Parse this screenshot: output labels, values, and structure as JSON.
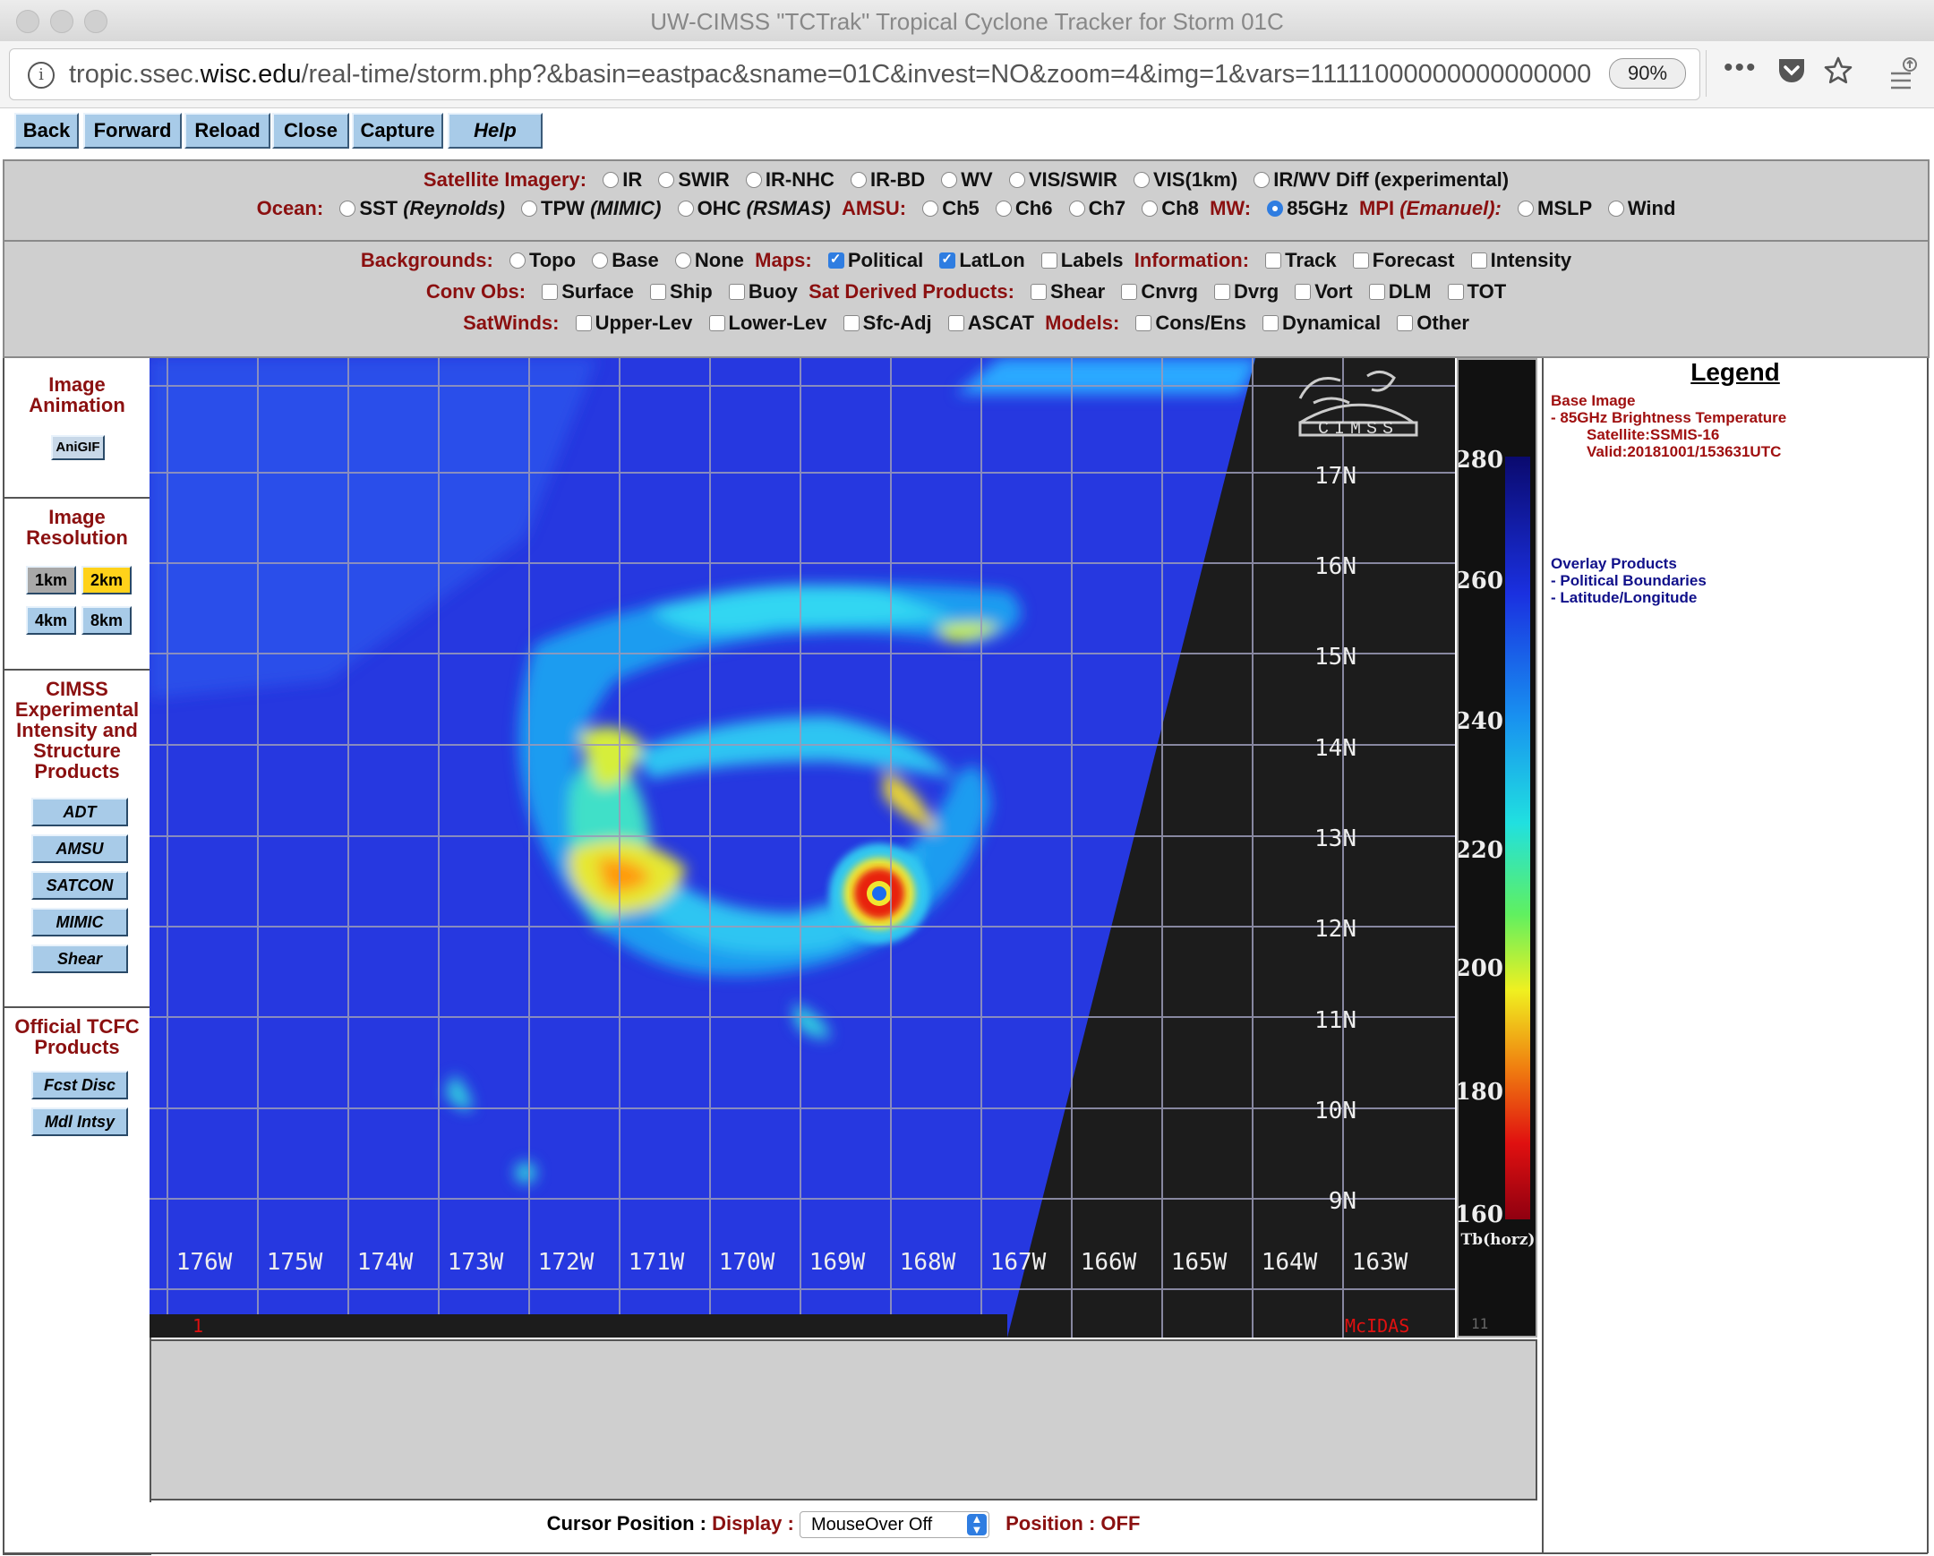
{
  "browser": {
    "window_title": "UW-CIMSS \"TCTrak\" Tropical Cyclone Tracker for Storm 01C",
    "url_prefix": "tropic.ssec.",
    "url_domain": "wisc.edu",
    "url_path": "/real-time/storm.php?&basin=eastpac&sname=01C&invest=NO&zoom=4&img=1&vars=111110000000000000000",
    "zoom_level": "90%"
  },
  "toolbar": {
    "back": "Back",
    "forward": "Forward",
    "reload": "Reload",
    "close": "Close",
    "capture": "Capture",
    "help": "Help"
  },
  "controls": {
    "satellite_label": "Satellite Imagery:",
    "satellite_options": [
      "IR",
      "SWIR",
      "IR-NHC",
      "IR-BD",
      "WV",
      "VIS/SWIR",
      "VIS(1km)",
      "IR/WV Diff (experimental)"
    ],
    "ocean_label": "Ocean:",
    "ocean_options": [
      "SST",
      "(Reynolds)",
      "TPW",
      "(MIMIC)",
      "OHC",
      "(RSMAS)"
    ],
    "amsu_label": "AMSU:",
    "amsu_options": [
      "Ch5",
      "Ch6",
      "Ch7",
      "Ch8"
    ],
    "mw_label": "MW:",
    "mw_option": "85GHz",
    "mpi_label": "MPI",
    "mpi_italic": "(Emanuel):",
    "mpi_options": [
      "MSLP",
      "Wind"
    ],
    "backgrounds_label": "Backgrounds:",
    "backgrounds_options": [
      "Topo",
      "Base",
      "None"
    ],
    "maps_label": "Maps:",
    "maps_options": [
      "Political",
      "LatLon",
      "Labels"
    ],
    "information_label": "Information:",
    "information_options": [
      "Track",
      "Forecast",
      "Intensity"
    ],
    "convobs_label": "Conv Obs:",
    "convobs_options": [
      "Surface",
      "Ship",
      "Buoy"
    ],
    "satderived_label": "Sat Derived Products:",
    "satderived_options": [
      "Shear",
      "Cnvrg",
      "Dvrg",
      "Vort",
      "DLM",
      "TOT"
    ],
    "satwinds_label": "SatWinds:",
    "satwinds_options": [
      "Upper-Lev",
      "Lower-Lev",
      "Sfc-Adj",
      "ASCAT"
    ],
    "models_label": "Models:",
    "models_options": [
      "Cons/Ens",
      "Dynamical",
      "Other"
    ]
  },
  "sidebar": {
    "animation_heading": [
      "Image",
      "Animation"
    ],
    "anigif": "AniGIF",
    "resolution_heading": [
      "Image",
      "Resolution"
    ],
    "res_1km": "1km",
    "res_2km": "2km",
    "res_4km": "4km",
    "res_8km": "8km",
    "cimss_heading": [
      "CIMSS",
      "Experimental",
      "Intensity and",
      "Structure",
      "Products"
    ],
    "adt": "ADT",
    "amsu": "AMSU",
    "satcon": "SATCON",
    "mimic": "MIMIC",
    "shear": "Shear",
    "official_heading": [
      "Official TCFC",
      "Products"
    ],
    "fcst_disc": "Fcst Disc",
    "mdl_intsy": "Mdl Intsy"
  },
  "map": {
    "lat_labels": [
      "17N",
      "16N",
      "15N",
      "14N",
      "13N",
      "12N",
      "11N",
      "10N",
      "9N"
    ],
    "lon_labels": [
      "176W",
      "175W",
      "174W",
      "173W",
      "172W",
      "171W",
      "170W",
      "169W",
      "168W",
      "167W",
      "166W",
      "165W",
      "164W",
      "163W"
    ],
    "frame_number": "1",
    "mcidas": "McIDAS",
    "logo_text": "CIMSS"
  },
  "colorbar": {
    "ticks": [
      "280",
      "260",
      "240",
      "220",
      "200",
      "180",
      "160"
    ],
    "unit": "Tb(horz)",
    "footer": "11"
  },
  "legend": {
    "title": "Legend",
    "base_heading": "Base Image",
    "base_item": "-  85GHz Brightness Temperature",
    "satellite": "Satellite:SSMIS-16",
    "valid": "Valid:20181001/153631UTC",
    "overlay_heading": "Overlay Products",
    "overlay_items": [
      "-  Political Boundaries",
      "-  Latitude/Longitude"
    ]
  },
  "cursor": {
    "label": "Cursor Position :",
    "display_label": "Display :",
    "display_value": "MouseOver Off",
    "position_label": "Position : OFF"
  }
}
